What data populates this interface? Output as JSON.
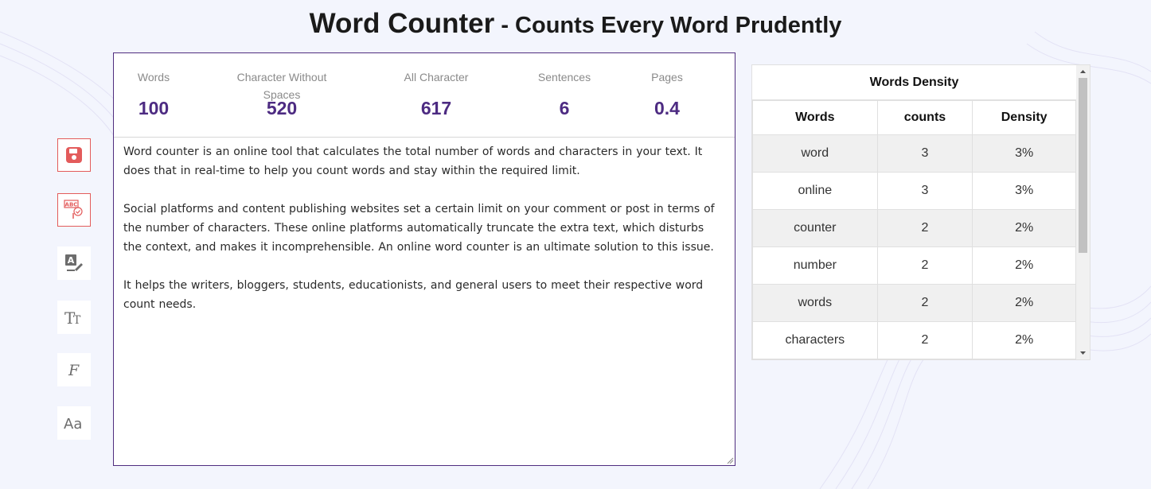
{
  "header": {
    "title_main": "Word Counter",
    "title_sub": " - Counts Every Word Prudently"
  },
  "stats": [
    {
      "label": "Words",
      "value": "100"
    },
    {
      "label": "Character Without Spaces",
      "value": "520"
    },
    {
      "label": "All Character",
      "value": "617"
    },
    {
      "label": "Sentences",
      "value": "6"
    },
    {
      "label": "Pages",
      "value": "0.4"
    }
  ],
  "editor": {
    "text": "Word counter is an online tool that calculates the total number of words and characters in your text. It does that in real-time to help you count words and stay within the required limit.\n\nSocial platforms and content publishing websites set a certain limit on your comment or post in terms of the number of characters. These online platforms automatically truncate the extra text, which disturbs the context, and makes it incomprehensible. An online word counter is an ultimate solution to this issue.\n\nIt helps the writers, bloggers, students, educationists, and general users to meet their respective word count needs."
  },
  "toolbar": {
    "items": [
      {
        "icon": "save-icon"
      },
      {
        "icon": "spell-check-icon"
      },
      {
        "icon": "grammar-check-icon"
      },
      {
        "icon": "text-size-icon"
      },
      {
        "icon": "font-style-icon"
      },
      {
        "icon": "text-case-icon"
      }
    ],
    "accent_color": "#e35b5b"
  },
  "density": {
    "title": "Words Density",
    "headers": [
      "Words",
      "counts",
      "Density"
    ],
    "rows": [
      [
        "word",
        "3",
        "3%"
      ],
      [
        "online",
        "3",
        "3%"
      ],
      [
        "counter",
        "2",
        "2%"
      ],
      [
        "number",
        "2",
        "2%"
      ],
      [
        "words",
        "2",
        "2%"
      ],
      [
        "characters",
        "2",
        "2%"
      ]
    ]
  },
  "colors": {
    "stat_value": "#4d2b82",
    "editor_border": "#4f2d7f",
    "page_bg": "#f3f5fd"
  }
}
